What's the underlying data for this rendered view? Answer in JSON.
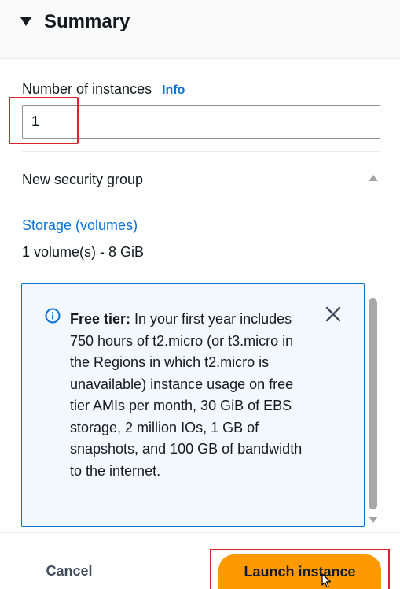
{
  "header": {
    "title": "Summary"
  },
  "instances": {
    "label": "Number of instances",
    "info_link": "Info",
    "value": "1"
  },
  "details": {
    "security_group": "New security group",
    "storage_link": "Storage (volumes)",
    "volume_summary": "1 volume(s) - 8 GiB"
  },
  "free_tier_alert": {
    "bold_label": "Free tier:",
    "message": " In your first year includes 750 hours of t2.micro (or t3.micro in the Regions in which t2.micro is unavailable) instance usage on free tier AMIs per month, 30 GiB of EBS storage, 2 million IOs, 1 GB of snapshots, and 100 GB of bandwidth to the internet."
  },
  "footer": {
    "cancel_label": "Cancel",
    "launch_label": "Launch instance"
  },
  "colors": {
    "accent_link": "#0972d3",
    "primary_button": "#ff9900",
    "highlight": "#e0202a",
    "alert_bg": "#f2f8fd"
  }
}
